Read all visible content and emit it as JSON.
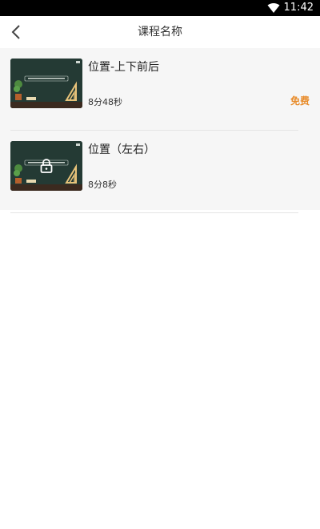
{
  "status_bar": {
    "time": "11:42"
  },
  "header": {
    "title": "课程名称"
  },
  "courses": [
    {
      "title": "位置-上下前后",
      "duration": "8分48秒",
      "badge": "免费",
      "locked": false
    },
    {
      "title": "位置（左右）",
      "duration": "8分8秒",
      "badge": "",
      "locked": true
    }
  ],
  "colors": {
    "free_badge": "#e88c2b",
    "chalkboard": "#243a34"
  }
}
